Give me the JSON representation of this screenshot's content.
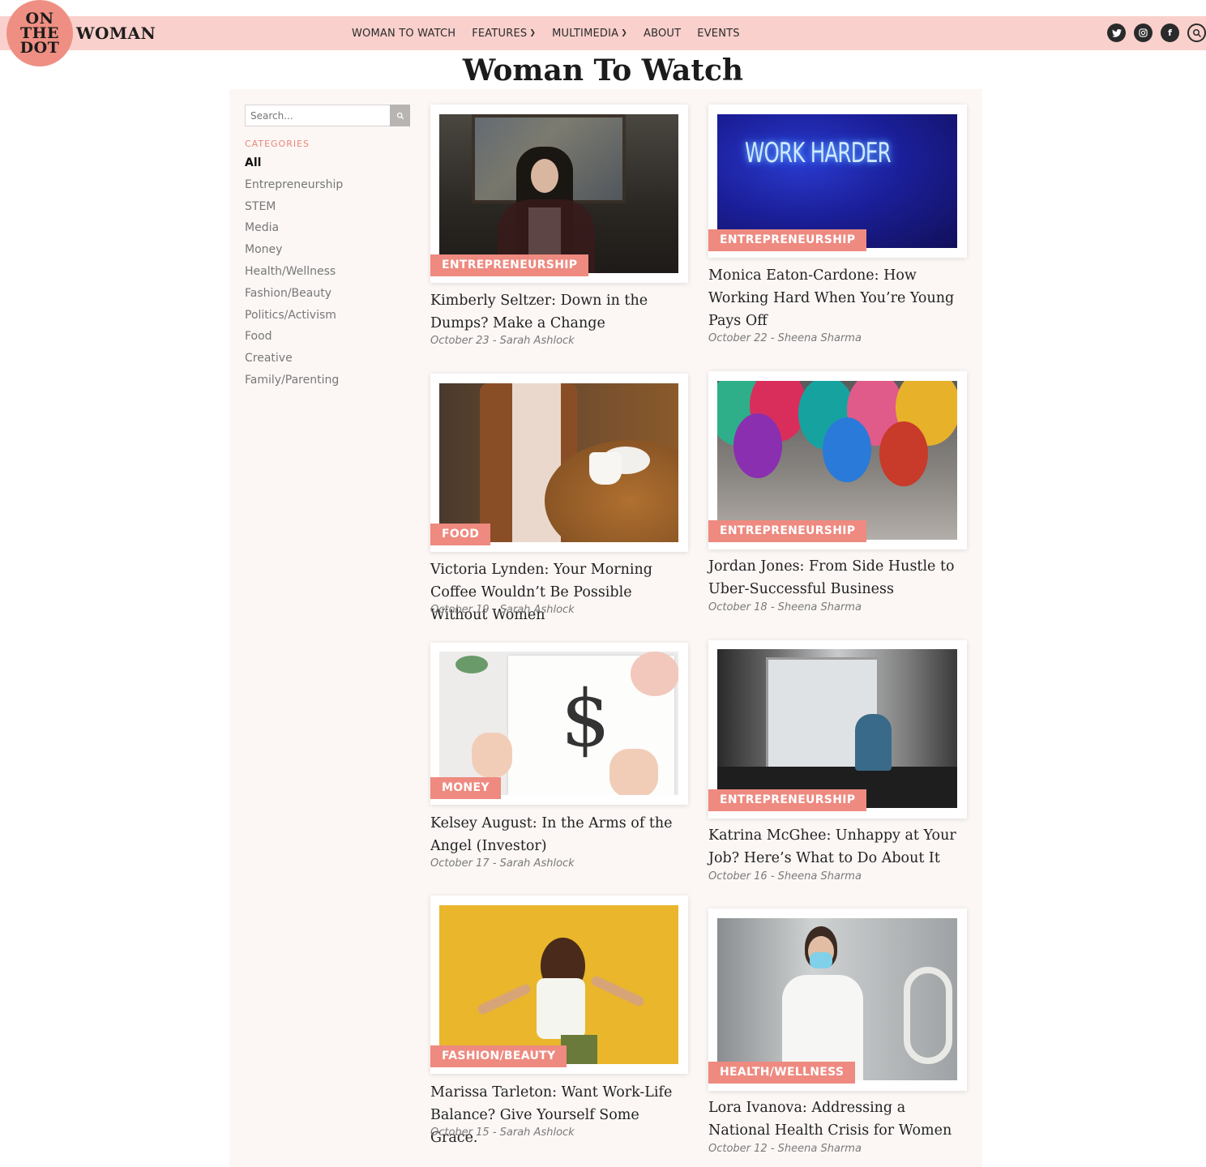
{
  "header": {
    "logo_lines": [
      "ON",
      "THE",
      "DOT"
    ],
    "logo_word": "WOMAN",
    "nav": [
      {
        "label": "WOMAN TO WATCH"
      },
      {
        "label": "FEATURES",
        "dropdown": true
      },
      {
        "label": "MULTIMEDIA",
        "dropdown": true
      },
      {
        "label": "ABOUT"
      },
      {
        "label": "EVENTS"
      }
    ],
    "social_icons": [
      "twitter-icon",
      "instagram-icon",
      "facebook-icon",
      "search-icon"
    ]
  },
  "page_title": "Woman To Watch",
  "sidebar": {
    "search_placeholder": "Search...",
    "categories_heading": "CATEGORIES",
    "categories": [
      "All",
      "Entrepreneurship",
      "STEM",
      "Media",
      "Money",
      "Health/Wellness",
      "Fashion/Beauty",
      "Politics/Activism",
      "Food",
      "Creative",
      "Family/Parenting"
    ]
  },
  "articles": [
    {
      "tag": "ENTREPRENEURSHIP",
      "title": "Kimberly Seltzer: Down in the Dumps? Make a Change",
      "meta": "October 23 - Sarah Ashlock"
    },
    {
      "tag": "ENTREPRENEURSHIP",
      "title": "Monica Eaton-Cardone: How Working Hard When You’re Young Pays Off",
      "meta": "October 22 - Sheena Sharma",
      "image_text": "WORK HARDER"
    },
    {
      "tag": "FOOD",
      "title": "Victoria Lynden: Your Morning Coffee Wouldn’t Be Possible Without Women",
      "meta": "October 19 - Sarah Ashlock"
    },
    {
      "tag": "ENTREPRENEURSHIP",
      "title": "Jordan Jones: From Side Hustle to Uber-Successful Business",
      "meta": "October 18 - Sheena Sharma"
    },
    {
      "tag": "MONEY",
      "title": "Kelsey August: In the Arms of the Angel (Investor)",
      "meta": "October 17 - Sarah Ashlock"
    },
    {
      "tag": "ENTREPRENEURSHIP",
      "title": "Katrina McGhee: Unhappy at Your Job? Here’s What to Do About It",
      "meta": "October 16 - Sheena Sharma"
    },
    {
      "tag": "FASHION/BEAUTY",
      "title": "Marissa Tarleton: Want Work-Life Balance? Give Yourself Some Grace.",
      "meta": "October 15 - Sarah Ashlock"
    },
    {
      "tag": "HEALTH/WELLNESS",
      "title": "Lora Ivanova: Addressing a National Health Crisis for Women",
      "meta": "October 12 - Sheena Sharma"
    }
  ],
  "colors": {
    "accent": "#ee8a80",
    "topbar": "#f9d0cc",
    "panel": "#fcf7f5"
  }
}
